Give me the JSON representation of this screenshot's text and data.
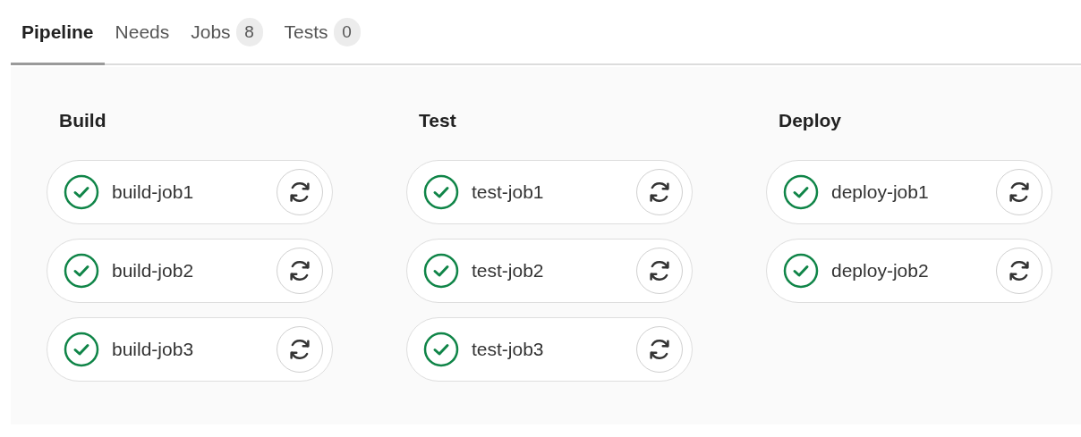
{
  "tabs": [
    {
      "label": "Pipeline",
      "selected": true
    },
    {
      "label": "Needs",
      "selected": false
    },
    {
      "label": "Jobs",
      "count": "8",
      "selected": false
    },
    {
      "label": "Tests",
      "count": "0",
      "selected": false
    }
  ],
  "stages": [
    {
      "title": "Build",
      "jobs": [
        {
          "name": "build-job1",
          "passed": true
        },
        {
          "name": "build-job2",
          "passed": true
        },
        {
          "name": "build-job3",
          "passed": true
        }
      ]
    },
    {
      "title": "Test",
      "jobs": [
        {
          "name": "test-job1",
          "passed": true
        },
        {
          "name": "test-job2",
          "passed": true
        },
        {
          "name": "test-job3",
          "passed": true
        }
      ]
    },
    {
      "title": "Deploy",
      "jobs": [
        {
          "name": "deploy-job1",
          "passed": true
        },
        {
          "name": "deploy-job2",
          "passed": true
        }
      ]
    }
  ]
}
